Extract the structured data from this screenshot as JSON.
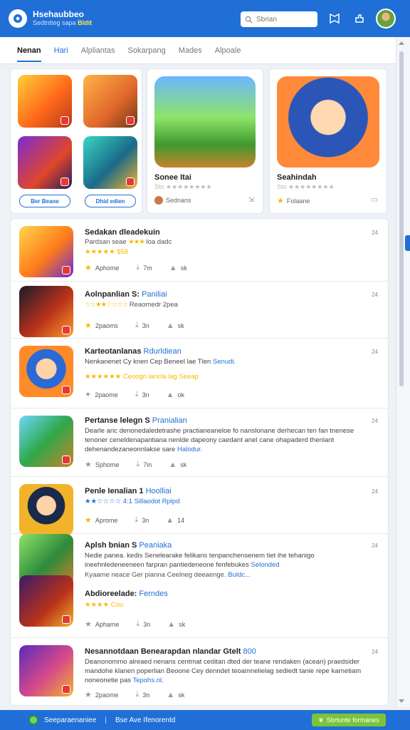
{
  "header": {
    "brand_title": "Hsehaubbeo",
    "brand_sub": "Sedtntteg sapa",
    "brand_sub_highlight": "Bldit",
    "search_placeholder": "Sbrian"
  },
  "nav": {
    "tabs": [
      "Nenan",
      "Hari",
      "Alpliantas",
      "Sokarpang",
      "Mades",
      "Alpoale"
    ]
  },
  "featured": {
    "mini_buttons": [
      "Ber Beane",
      "Dhid edien"
    ],
    "card_b": {
      "title": "Sonee Itai",
      "stars_label": "Sto",
      "foot": "Sednans"
    },
    "card_c": {
      "title": "Seahindah",
      "stars_label": "Sto",
      "foot": "Folaane"
    }
  },
  "list": [
    {
      "title": "Sedakan dleadekuin",
      "tag": "",
      "sub": "Pardsan seae",
      "stars": "★★★",
      "sub_after": "loa dadc",
      "sub2": "★★★★★ $58",
      "actions": [
        "Aphome",
        "7m",
        "sk"
      ],
      "num": "24"
    },
    {
      "title": "Aolnpanlian S:",
      "tag": "Paniliai",
      "sub": "☆☆★★☆☆☆☆",
      "sub_after": "Reaomedr 2pea",
      "actions": [
        "2paoms",
        "3n",
        "sk"
      ],
      "num": "24"
    },
    {
      "title": "Karteotanlanas",
      "tag": "Rdurldiean",
      "desc": "Nenkanenet Cy knen Cep Beneel lae Tlen",
      "desc_link": "Senudi.",
      "sub2": "★★★★★★ Ceoogn lancla lag Seeap",
      "actions": [
        "2paome",
        "3n",
        "ok"
      ],
      "num": "24"
    },
    {
      "title": "Pertanse lelegn S",
      "tag": "Pranialian",
      "desc": "Dearle aric denonedaledetrashe practianeaneloe fo nanslonane derhecan ten fan tnenese tenoner ceneldenapantiana nenlde dapeony caedant anel cane ohapaderd thenlant dehenandezaneonnlakse sare",
      "desc_link": "Halodur.",
      "actions": [
        "Sphome",
        "7in",
        "sk"
      ],
      "num": "24"
    },
    {
      "title": "Penle Ienalian 1",
      "tag": "Hoolliai",
      "sub": "★★☆☆☆☆ 4:1 Sillaodot Rplpd",
      "actions": [
        "Aprome",
        "3n",
        "14"
      ],
      "num": "24"
    },
    {
      "title": "Aplsh bnian S",
      "tag": "Peaniaka",
      "desc": "Nedie panea. kedis Senelearake felikans tenpanchensenem tiet ihe tehanigo ineehnledeneeneen farpran pantiedeneone fenfebukes",
      "desc_link": "Selonded",
      "desc2": "Kyaame neace Ger pianna Ceelneg deeaenge.",
      "desc2_link": "Buldc...",
      "title2": "Abdioreelade:",
      "tag2": "Ferndes",
      "sub2": "★★★★ Cou",
      "actions": [
        "Aphame",
        "3n",
        "sk"
      ],
      "num": "24"
    },
    {
      "title": "Nesannotdaan Benearapdan nlandar Gtelt",
      "tag": "800",
      "desc": "Deanonommo alreaed nenans centmat ceditan dted der teane rendaken (acean) praedsider mandohe klanen poperlian Beoone Cey denndet teoamnelielag sediedt tanie repe karnetiam noneonetie pas",
      "desc_link": "Tepohs.nl.",
      "actions": [
        "2paome",
        "3n",
        "sk"
      ],
      "num": "24"
    }
  ],
  "bottom": {
    "left": "Seeparaenaniee",
    "sep": "|",
    "mid": "Bse Ave Ifenorentd",
    "button": "Sbrtunte formanes"
  },
  "colors": {
    "primary": "#1f6fd6",
    "star": "#f6b900",
    "green": "#7bc43a"
  }
}
